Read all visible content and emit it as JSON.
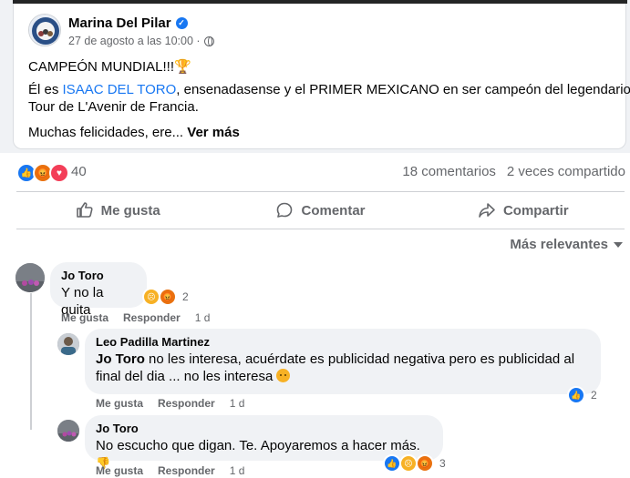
{
  "post": {
    "page_name": "Marina Del Pilar",
    "timestamp": "27 de agosto a las 10:00 ·",
    "line1": "CAMPEÓN MUNDIAL!!!🏆",
    "line2_pre": "Él es ",
    "line2_mention": "ISAAC DEL TORO",
    "line2_post": ", ensenadasense y el PRIMER MEXICANO en ser campeón del legendario",
    "line3": "Tour de L'Avenir de Francia.",
    "line4": "Muchas felicidades, ere... ",
    "see_more": "Ver más"
  },
  "stats": {
    "reaction_count": "40",
    "comments": "18 comentarios",
    "shares": "2 veces compartido"
  },
  "actions": {
    "like": "Me gusta",
    "comment": "Comentar",
    "share": "Compartir"
  },
  "sort": {
    "label": "Más relevantes"
  },
  "comments": [
    {
      "author": "Jo Toro",
      "text": "Y no la quita",
      "reactions": "2",
      "like": "Me gusta",
      "reply": "Responder",
      "time": "1 d"
    },
    {
      "author": "Leo Padilla Martinez",
      "tag": "Jo Toro",
      "text1": " no les interesa, acuérdate es publicidad negativa pero es publicidad al",
      "text2": "final del dia ... no les interesa ",
      "reactions": "2",
      "like": "Me gusta",
      "reply": "Responder",
      "time": "1 d"
    },
    {
      "author": "Jo Toro",
      "text": "No escucho que digan. Te. Apoyaremos a hacer más. ",
      "reactions": "3",
      "like": "Me gusta",
      "reply": "Responder",
      "time": "1 d"
    }
  ],
  "colors": {
    "accent": "#1877f2",
    "muted": "#65676b",
    "bubble": "#f0f2f5"
  }
}
